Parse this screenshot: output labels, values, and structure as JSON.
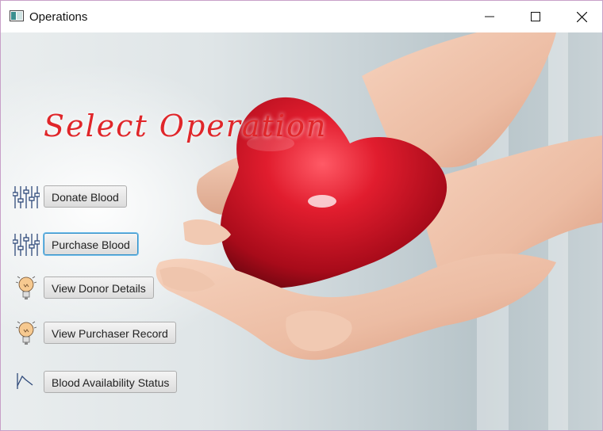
{
  "window": {
    "title": "Operations",
    "controls": [
      "minimize",
      "maximize",
      "close"
    ]
  },
  "heading": "Select Operation",
  "operations": [
    {
      "label": "Donate Blood",
      "icon": "sliders-icon"
    },
    {
      "label": "Purchase Blood",
      "icon": "sliders-icon",
      "focused": true
    },
    {
      "label": "View Donor Details",
      "icon": "lightbulb-icon"
    },
    {
      "label": "View Purchaser Record",
      "icon": "lightbulb-icon"
    },
    {
      "label": "Blood Availability Status",
      "icon": "line-chart-icon"
    }
  ],
  "colors": {
    "heading": "#e0262a",
    "focus_border": "#2f8fc9",
    "heart": "#d9182c"
  }
}
